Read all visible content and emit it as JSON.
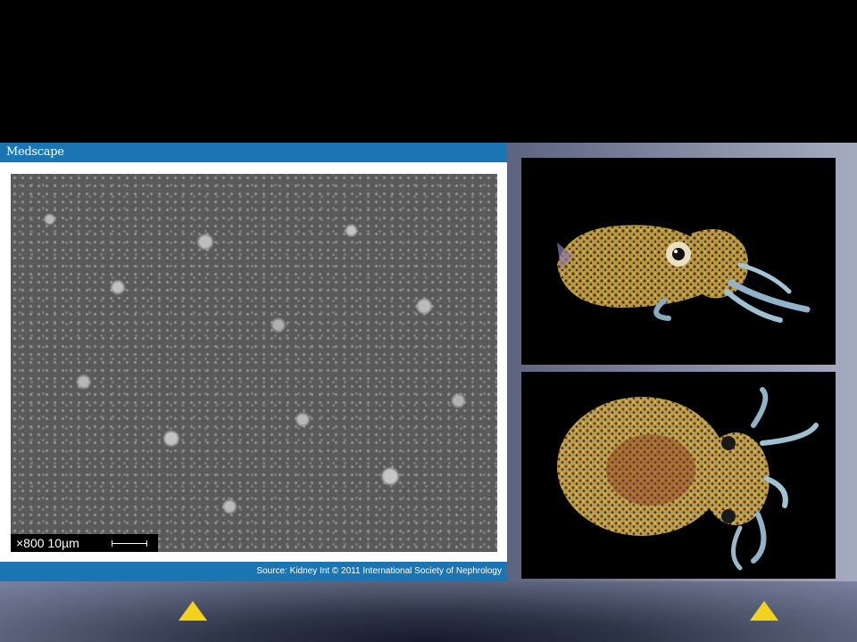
{
  "medscape_panel": {
    "logo": "Medscape",
    "source": "Source: Kidney Int © 2011 International Society of Nephrology",
    "scale_label": "×800 10µm",
    "header_color": "#1b75b3"
  },
  "photos": {
    "top": {
      "icon": "squid-side-view-icon"
    },
    "bottom": {
      "icon": "squid-top-view-icon"
    }
  },
  "navigation": {
    "left_arrow_icon": "triangle-up-icon",
    "right_arrow_icon": "triangle-up-icon",
    "arrow_color": "#f2d21a"
  }
}
